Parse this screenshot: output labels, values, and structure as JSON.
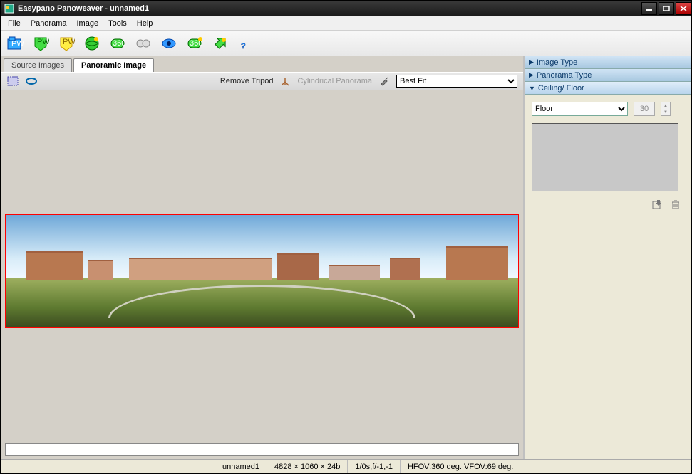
{
  "window": {
    "title": "Easypano Panoweaver - unnamed1"
  },
  "menus": {
    "file": "File",
    "panorama": "Panorama",
    "image": "Image",
    "tools": "Tools",
    "help": "Help"
  },
  "toolbar_icons": [
    "open-icon",
    "save-green-icon",
    "save-yellow-icon",
    "globe-icon",
    "preview-360-icon",
    "link-icon",
    "eye-icon",
    "spherical-icon",
    "export-icon",
    "help-icon"
  ],
  "tabs": {
    "source": "Source Images",
    "panoramic": "Panoramic Image",
    "active": "panoramic"
  },
  "subbar": {
    "remove_tripod": "Remove Tripod",
    "cyl_label": "Cylindrical Panorama",
    "fit_options": [
      "Best Fit"
    ],
    "fit_selected": "Best Fit"
  },
  "accordion": {
    "image_type": "Image Type",
    "panorama_type": "Panorama Type",
    "ceiling_floor": "Ceiling/ Floor",
    "floor_options": [
      "Floor"
    ],
    "floor_selected": "Floor",
    "angle_value": "30"
  },
  "status": {
    "file": "unnamed1",
    "dims": "4828 × 1060 × 24b",
    "exif": "1/0s,f/-1,-1",
    "fov": "HFOV:360 deg. VFOV:69 deg."
  }
}
